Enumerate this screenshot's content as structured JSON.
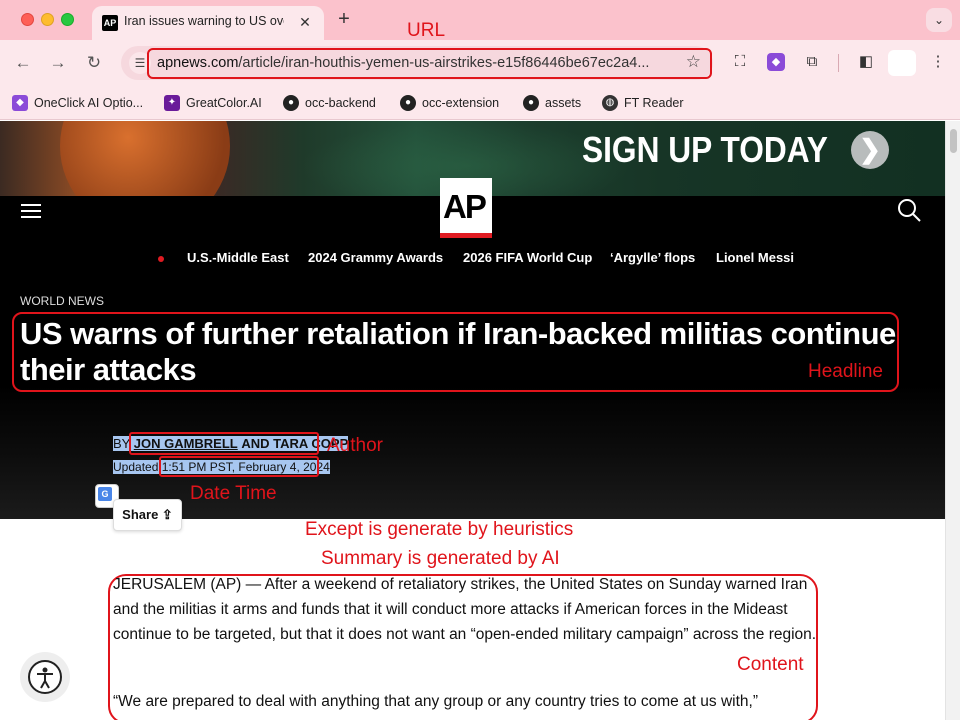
{
  "browser": {
    "tab_title": "Iran issues warning to US over",
    "tab_favicon": "AP",
    "new_tab_label": "+",
    "url_host": "apnews.com",
    "url_path": "/article/iran-houthis-yemen-us-airstrikes-e15f86446be67ec2a4...",
    "bookmarks": [
      {
        "label": "OneClick AI Optio...",
        "icon": "oneclick-icon",
        "color": "#8b4bd8"
      },
      {
        "label": "GreatColor.AI",
        "icon": "greatcolor-icon",
        "color": "#c2185b"
      },
      {
        "label": "occ-backend",
        "icon": "github-icon",
        "color": "#222222"
      },
      {
        "label": "occ-extension",
        "icon": "github-icon",
        "color": "#222222"
      },
      {
        "label": "assets",
        "icon": "github-icon",
        "color": "#222222"
      },
      {
        "label": "FT Reader",
        "icon": "globe-icon",
        "color": "#333333"
      }
    ]
  },
  "ad": {
    "headline": "SIGN UP TODAY",
    "button": "❯"
  },
  "site": {
    "logo": "AP",
    "topics": [
      "U.S.-Middle East",
      "2024 Grammy Awards",
      "2026 FIFA World Cup",
      "‘Argylle’ flops",
      "Lionel Messi"
    ]
  },
  "article": {
    "section": "WORLD NEWS",
    "headline": "US warns of further retaliation if Iran-backed militias continue their attacks",
    "byline_by": "BY",
    "author_1": "JON GAMBRELL",
    "byline_and": "AND TARA COPP",
    "updated_label": "Updated",
    "updated_time": "1:51 PM PST, February 4, 2024",
    "share_label": "Share",
    "paragraphs": [
      "JERUSALEM (AP) — After a weekend of retaliatory strikes, the United States on Sunday warned Iran and the militias it arms and funds that it will conduct more attacks if American forces in the Mideast continue to be targeted, but that it does not want an “open-ended military campaign” across the region.",
      "“We are prepared to deal with anything that any group or any country tries to come at us with,”"
    ]
  },
  "annotations": {
    "url": "URL",
    "headline": "Headline",
    "author": "Author",
    "date_time": "Date Time",
    "note_line1": "Except is generate by heuristics",
    "note_line2": "Summary is generated by AI",
    "content": "Content"
  },
  "colors": {
    "annotation_red": "#e0141b",
    "chrome_pink": "#fbc2cc",
    "ap_red": "#e01b22",
    "selection_blue": "#a7c6f0"
  }
}
